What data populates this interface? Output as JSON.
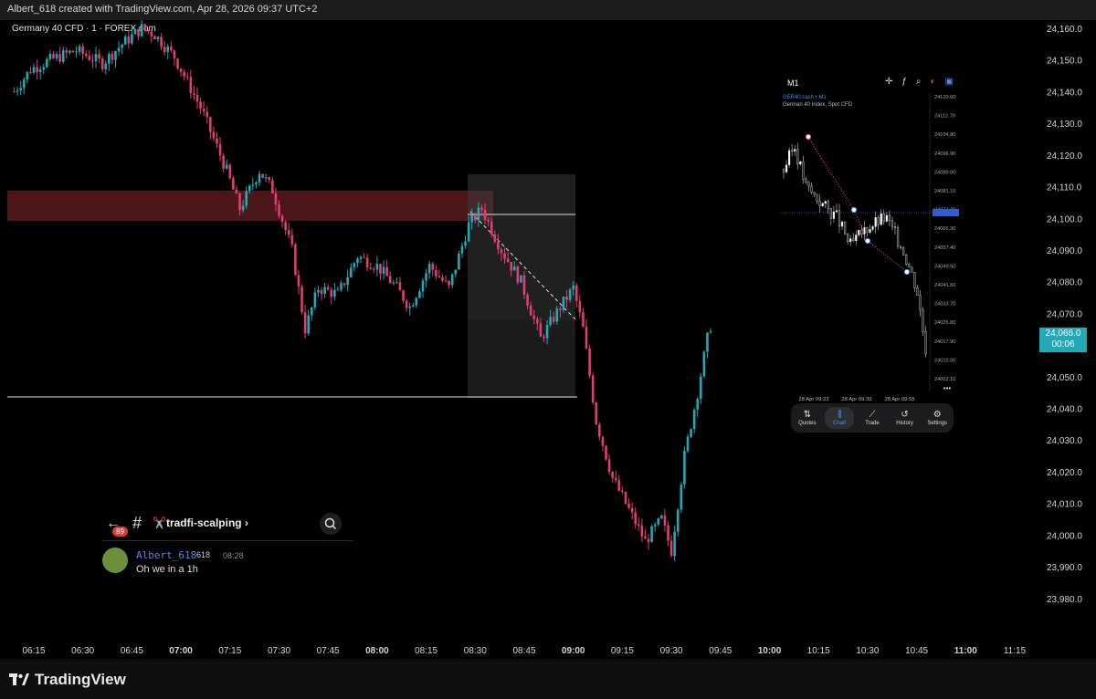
{
  "header": {
    "attribution": "Albert_618 created with TradingView.com, Apr 28, 2026 09:37 UTC+2",
    "symbol": "Germany 40 CFD · 1 · FOREX.com"
  },
  "price_tag": {
    "price": "24,066.0",
    "timer": "00:06"
  },
  "footer": {
    "brand": "TradingView"
  },
  "inset": {
    "timeframe": "M1",
    "symbol": "GER40.cash • M1",
    "description": "German 40 Index, Spot CFD",
    "y_ticks": [
      "24120.60",
      "24112.70",
      "24104.80",
      "24096.90",
      "24089.00",
      "24081.10",
      "24073.20",
      "24065.30",
      "24057.40",
      "24049.50",
      "24041.60",
      "24033.70",
      "24025.80",
      "24017.90",
      "24010.00",
      "24002.10"
    ],
    "x_ticks": [
      "28 Apr 09:23",
      "28 Apr 09:39",
      "28 Apr 09:55"
    ],
    "more": "•••",
    "nav": [
      {
        "label": "Quotes",
        "icon": "⇅"
      },
      {
        "label": "Chart",
        "icon": "⫼"
      },
      {
        "label": "Trade",
        "icon": "⟋"
      },
      {
        "label": "History",
        "icon": "↺"
      },
      {
        "label": "Settings",
        "icon": "⚙"
      }
    ]
  },
  "chat": {
    "unread": "89",
    "channel": "✂️tradfi-scalping ›",
    "message": {
      "user": "Albert_618",
      "role": "618",
      "time": "08:28",
      "text": "Oh we in a 1h"
    }
  },
  "colors": {
    "up": "#22a9b6",
    "down": "#e23d73",
    "zone": "#5a1a20",
    "bg": "#000000"
  },
  "chart_data": {
    "type": "candlestick",
    "title": "Germany 40 CFD · 1 · FOREX.com",
    "y_ticks": [
      23980,
      23990,
      24000,
      24010,
      24020,
      24030,
      24040,
      24050,
      24060,
      24070,
      24080,
      24090,
      24100,
      24110,
      24120,
      24130,
      24140,
      24150,
      24160
    ],
    "ylim": [
      23977,
      24164
    ],
    "x_ticks": [
      "06:15",
      "06:30",
      "06:45",
      "07:00",
      "07:15",
      "07:30",
      "07:45",
      "08:00",
      "08:15",
      "08:30",
      "08:45",
      "09:00",
      "09:15",
      "09:30",
      "09:45",
      "10:00",
      "10:15",
      "10:30",
      "10:45",
      "11:00",
      "11:15"
    ],
    "bold_ticks": [
      "07:00",
      "08:00",
      "09:00",
      "10:00",
      "11:00"
    ],
    "levels": {
      "supply_zone": [
        24101.5,
        24111
      ],
      "resistance": 24102,
      "support": 24047
    },
    "last_price": 24066.0,
    "path": [
      {
        "t": "06:09",
        "p": 24140
      },
      {
        "t": "06:14",
        "p": 24147
      },
      {
        "t": "06:20",
        "p": 24150
      },
      {
        "t": "06:28",
        "p": 24153
      },
      {
        "t": "06:36",
        "p": 24149
      },
      {
        "t": "06:42",
        "p": 24155
      },
      {
        "t": "06:48",
        "p": 24160
      },
      {
        "t": "06:52",
        "p": 24158
      },
      {
        "t": "06:58",
        "p": 24151
      },
      {
        "t": "07:06",
        "p": 24135
      },
      {
        "t": "07:14",
        "p": 24115
      },
      {
        "t": "07:18",
        "p": 24103
      },
      {
        "t": "07:24",
        "p": 24115
      },
      {
        "t": "07:28",
        "p": 24109
      },
      {
        "t": "07:34",
        "p": 24090
      },
      {
        "t": "07:38",
        "p": 24065
      },
      {
        "t": "07:42",
        "p": 24078
      },
      {
        "t": "07:48",
        "p": 24076
      },
      {
        "t": "07:54",
        "p": 24088
      },
      {
        "t": "08:00",
        "p": 24085
      },
      {
        "t": "08:06",
        "p": 24078
      },
      {
        "t": "08:10",
        "p": 24072
      },
      {
        "t": "08:16",
        "p": 24085
      },
      {
        "t": "08:22",
        "p": 24078
      },
      {
        "t": "08:28",
        "p": 24098
      },
      {
        "t": "08:32",
        "p": 24103
      },
      {
        "t": "08:38",
        "p": 24090
      },
      {
        "t": "08:44",
        "p": 24080
      },
      {
        "t": "08:50",
        "p": 24062
      },
      {
        "t": "08:56",
        "p": 24072
      },
      {
        "t": "09:00",
        "p": 24078
      },
      {
        "t": "09:03",
        "p": 24065
      },
      {
        "t": "09:07",
        "p": 24036
      },
      {
        "t": "09:12",
        "p": 24018
      },
      {
        "t": "09:17",
        "p": 24008
      },
      {
        "t": "09:22",
        "p": 23998
      },
      {
        "t": "09:27",
        "p": 24005
      },
      {
        "t": "09:30",
        "p": 23995
      },
      {
        "t": "09:34",
        "p": 24025
      },
      {
        "t": "09:38",
        "p": 24045
      },
      {
        "t": "09:41",
        "p": 24062
      },
      {
        "t": "09:42",
        "p": 24066
      }
    ]
  }
}
